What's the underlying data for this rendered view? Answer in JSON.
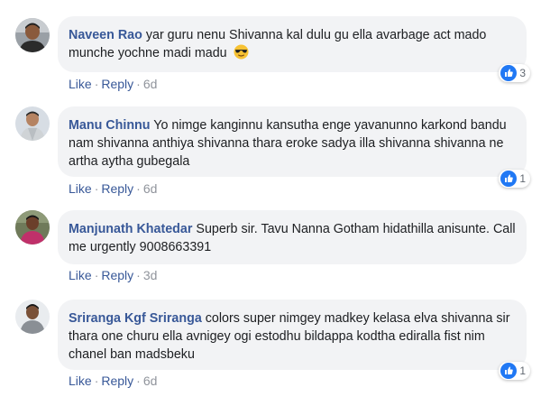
{
  "comments": [
    {
      "author": "Naveen Rao",
      "text": "yar guru nenu Shivanna kal dulu gu ella avarbage act mado munche yochne madi madu",
      "emoji": "sunglasses-emoji",
      "reactions": "3",
      "like": "Like",
      "reply": "Reply",
      "time": "6d"
    },
    {
      "author": "Manu Chinnu",
      "text": "Yo nimge kanginnu kansutha enge yavanunno karkond bandu nam shivanna anthiya shivanna thara eroke sadya illa shivanna shivanna ne artha aytha gubegala",
      "reactions": "1",
      "like": "Like",
      "reply": "Reply",
      "time": "6d"
    },
    {
      "author": "Manjunath Khatedar",
      "text": "Superb sir. Tavu Nanna Gotham hidathilla anisunte. Call me urgently 9008663391",
      "like": "Like",
      "reply": "Reply",
      "time": "3d"
    },
    {
      "author": "Sriranga Kgf Sriranga",
      "text": "colors super nimgey madkey kelasa elva shivanna sir thara one churu ella avnigey ogi estodhu bildappa kodtha ediralla fist nim chanel ban madsbeku",
      "reactions": "1",
      "like": "Like",
      "reply": "Reply",
      "time": "6d"
    }
  ],
  "separator": "·",
  "colors": {
    "author": "#385898",
    "bubble": "#f2f3f5",
    "like_blue": "#2078f4"
  },
  "icons": {
    "like": "thumbs-up-icon",
    "emoji": "sunglasses-emoji"
  }
}
